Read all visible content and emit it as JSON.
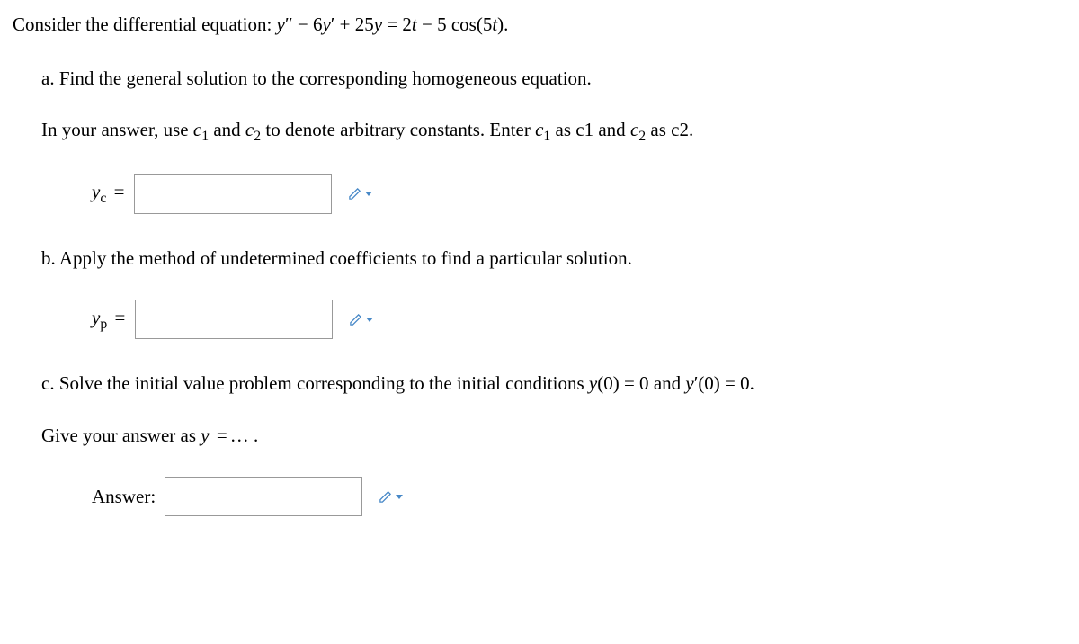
{
  "intro": {
    "prefix": "Consider the differential equation:   ",
    "equation_y2": "y",
    "equation_p2": "″",
    "equation_m1": " − 6",
    "equation_y1": "y",
    "equation_p1": "′",
    "equation_m2": " + 25",
    "equation_y0": "y",
    "equation_eq": " = 2",
    "equation_t": "t",
    "equation_m3": " − 5 cos(5",
    "equation_t2": "t",
    "equation_end": ")."
  },
  "part_a": {
    "label": "a. ",
    "text": "Find the general solution to the corresponding homogeneous equation.",
    "sub_prefix": "In your answer, use ",
    "c1": "c",
    "sub1": "1",
    "and": " and ",
    "c2": "c",
    "sub2": "2",
    "mid": " to denote arbitrary constants. Enter ",
    "c1b": "c",
    "sub1b": "1",
    "as1": " as c1 and ",
    "c2b": "c",
    "sub2b": "2",
    "as2": " as c2.",
    "answer_label_y": "y",
    "answer_label_sub": "c",
    "answer_label_eq": " ="
  },
  "part_b": {
    "label": "b. ",
    "text": "Apply the method of undetermined coefficients to find a particular solution.",
    "answer_label_y": "y",
    "answer_label_sub": "p",
    "answer_label_eq": " ="
  },
  "part_c": {
    "label": "c. ",
    "text_prefix": "Solve the initial value problem corresponding to the initial conditions ",
    "y0": "y",
    "y0_arg": "(0) = 0",
    "and": " and ",
    "yp0": "y",
    "yp0_prime": "′",
    "yp0_arg": "(0) = 0.",
    "sub_prefix": "Give your answer as ",
    "y": "y",
    "eq": " =",
    "dots": "… .",
    "answer_label": "Answer:"
  }
}
